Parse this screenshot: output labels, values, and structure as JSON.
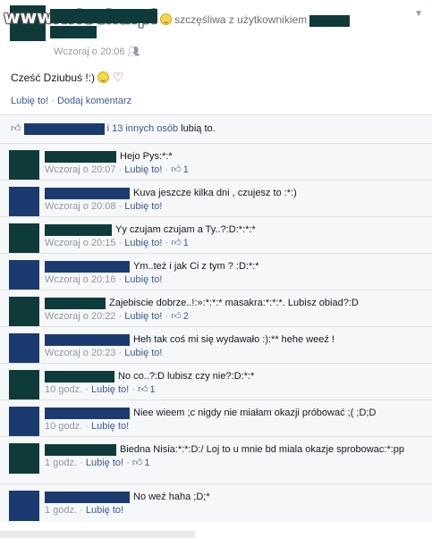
{
  "post": {
    "watermark": "www.wiocha.pl",
    "feeling": "szczęśliwa z użytkownikiem",
    "time": "Wczoraj o 20:06",
    "privacy_icon": "friends-icon",
    "text": "Cześć Dziubuś !:)",
    "actions": {
      "like": "Lubię to!",
      "separator": " · ",
      "comment": "Dodaj komentarz"
    },
    "likes_summary_link": "i 13 innych osób",
    "likes_summary_rest": " lubią to."
  },
  "comments": [
    {
      "text": "Hejo Pys:*:*",
      "time": "Wczoraj o 20:07",
      "like": "Lubię to!",
      "likes": "1",
      "avatar": "#0f3a3a",
      "bar": 80
    },
    {
      "text": "Kuva jeszcze kilka dni , czujesz to :*:)",
      "time": "Wczoraj o 20:08",
      "like": "Lubię to!",
      "likes": "",
      "avatar": "#1b3a70",
      "bar": 95
    },
    {
      "text": "Yy czujam czujam a Ty..?:D:*:*:*",
      "time": "Wczoraj o 20:15",
      "like": "Lubię to!",
      "likes": "1",
      "avatar": "#0f3a3a",
      "bar": 75
    },
    {
      "text": "Ym..też  i jak Ci z tym ? :D:*:*",
      "time": "Wczoraj o 20:16",
      "like": "Lubię to!",
      "likes": "",
      "avatar": "#1b3a70",
      "bar": 95
    },
    {
      "text": "Zajebiscie dobrze..!:»:*:*:* masakra:*:*:*. Lubisz obiad?:D",
      "time": "Wczoraj o 20:22",
      "like": "Lubię to!",
      "likes": "2",
      "avatar": "#0f3a3a",
      "bar": 68
    },
    {
      "text": "Heh tak coś mi się wydawało :):** hehe weeź !",
      "time": "Wczoraj o 20:23",
      "like": "Lubię to!",
      "likes": "",
      "avatar": "#1b3a70",
      "bar": 95
    },
    {
      "text": "No co..?:D lubisz czy nie?:D:*:*",
      "time": "10 godz.",
      "like": "Lubię to!",
      "likes": "1",
      "avatar": "#0f3a3a",
      "bar": 78
    },
    {
      "text": "Niee wieem ;c nigdy nie miałam okazji próbować ;( ;D;D",
      "time": "10 godz.",
      "like": "Lubię to!",
      "likes": "",
      "avatar": "#1b3a70",
      "bar": 95
    },
    {
      "text": "Biedna Nisia:*:*:D:/ Loj to u mnie bd miala okazje sprobowac:*:pp",
      "time": "1 godz.",
      "like": "Lubię to!",
      "likes": "1",
      "avatar": "#0f3a3a",
      "bar": 80
    },
    {
      "text": "No weź  haha ;D;*",
      "time": "1 godz.",
      "like": "Lubię to!",
      "likes": "",
      "avatar": "#1b3a70",
      "bar": 95
    }
  ],
  "colors": {
    "link": "#3b5998",
    "meta": "#9197a3",
    "bar_blue": "#1b3a70",
    "bar_green": "#0f3a3a"
  }
}
